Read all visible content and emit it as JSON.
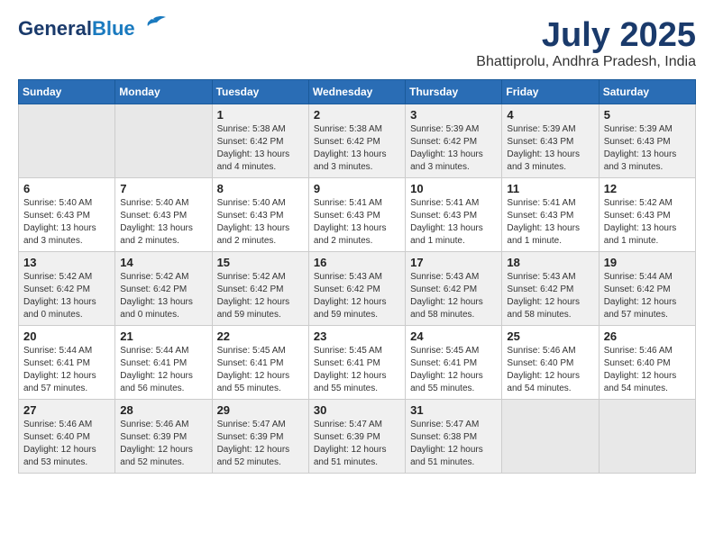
{
  "header": {
    "logo_line1": "General",
    "logo_line2": "Blue",
    "month": "July 2025",
    "location": "Bhattiprolu, Andhra Pradesh, India"
  },
  "days_of_week": [
    "Sunday",
    "Monday",
    "Tuesday",
    "Wednesday",
    "Thursday",
    "Friday",
    "Saturday"
  ],
  "weeks": [
    [
      {
        "day": "",
        "info": ""
      },
      {
        "day": "",
        "info": ""
      },
      {
        "day": "1",
        "info": "Sunrise: 5:38 AM\nSunset: 6:42 PM\nDaylight: 13 hours\nand 4 minutes."
      },
      {
        "day": "2",
        "info": "Sunrise: 5:38 AM\nSunset: 6:42 PM\nDaylight: 13 hours\nand 3 minutes."
      },
      {
        "day": "3",
        "info": "Sunrise: 5:39 AM\nSunset: 6:42 PM\nDaylight: 13 hours\nand 3 minutes."
      },
      {
        "day": "4",
        "info": "Sunrise: 5:39 AM\nSunset: 6:43 PM\nDaylight: 13 hours\nand 3 minutes."
      },
      {
        "day": "5",
        "info": "Sunrise: 5:39 AM\nSunset: 6:43 PM\nDaylight: 13 hours\nand 3 minutes."
      }
    ],
    [
      {
        "day": "6",
        "info": "Sunrise: 5:40 AM\nSunset: 6:43 PM\nDaylight: 13 hours\nand 3 minutes."
      },
      {
        "day": "7",
        "info": "Sunrise: 5:40 AM\nSunset: 6:43 PM\nDaylight: 13 hours\nand 2 minutes."
      },
      {
        "day": "8",
        "info": "Sunrise: 5:40 AM\nSunset: 6:43 PM\nDaylight: 13 hours\nand 2 minutes."
      },
      {
        "day": "9",
        "info": "Sunrise: 5:41 AM\nSunset: 6:43 PM\nDaylight: 13 hours\nand 2 minutes."
      },
      {
        "day": "10",
        "info": "Sunrise: 5:41 AM\nSunset: 6:43 PM\nDaylight: 13 hours\nand 1 minute."
      },
      {
        "day": "11",
        "info": "Sunrise: 5:41 AM\nSunset: 6:43 PM\nDaylight: 13 hours\nand 1 minute."
      },
      {
        "day": "12",
        "info": "Sunrise: 5:42 AM\nSunset: 6:43 PM\nDaylight: 13 hours\nand 1 minute."
      }
    ],
    [
      {
        "day": "13",
        "info": "Sunrise: 5:42 AM\nSunset: 6:42 PM\nDaylight: 13 hours\nand 0 minutes."
      },
      {
        "day": "14",
        "info": "Sunrise: 5:42 AM\nSunset: 6:42 PM\nDaylight: 13 hours\nand 0 minutes."
      },
      {
        "day": "15",
        "info": "Sunrise: 5:42 AM\nSunset: 6:42 PM\nDaylight: 12 hours\nand 59 minutes."
      },
      {
        "day": "16",
        "info": "Sunrise: 5:43 AM\nSunset: 6:42 PM\nDaylight: 12 hours\nand 59 minutes."
      },
      {
        "day": "17",
        "info": "Sunrise: 5:43 AM\nSunset: 6:42 PM\nDaylight: 12 hours\nand 58 minutes."
      },
      {
        "day": "18",
        "info": "Sunrise: 5:43 AM\nSunset: 6:42 PM\nDaylight: 12 hours\nand 58 minutes."
      },
      {
        "day": "19",
        "info": "Sunrise: 5:44 AM\nSunset: 6:42 PM\nDaylight: 12 hours\nand 57 minutes."
      }
    ],
    [
      {
        "day": "20",
        "info": "Sunrise: 5:44 AM\nSunset: 6:41 PM\nDaylight: 12 hours\nand 57 minutes."
      },
      {
        "day": "21",
        "info": "Sunrise: 5:44 AM\nSunset: 6:41 PM\nDaylight: 12 hours\nand 56 minutes."
      },
      {
        "day": "22",
        "info": "Sunrise: 5:45 AM\nSunset: 6:41 PM\nDaylight: 12 hours\nand 55 minutes."
      },
      {
        "day": "23",
        "info": "Sunrise: 5:45 AM\nSunset: 6:41 PM\nDaylight: 12 hours\nand 55 minutes."
      },
      {
        "day": "24",
        "info": "Sunrise: 5:45 AM\nSunset: 6:41 PM\nDaylight: 12 hours\nand 55 minutes."
      },
      {
        "day": "25",
        "info": "Sunrise: 5:46 AM\nSunset: 6:40 PM\nDaylight: 12 hours\nand 54 minutes."
      },
      {
        "day": "26",
        "info": "Sunrise: 5:46 AM\nSunset: 6:40 PM\nDaylight: 12 hours\nand 54 minutes."
      }
    ],
    [
      {
        "day": "27",
        "info": "Sunrise: 5:46 AM\nSunset: 6:40 PM\nDaylight: 12 hours\nand 53 minutes."
      },
      {
        "day": "28",
        "info": "Sunrise: 5:46 AM\nSunset: 6:39 PM\nDaylight: 12 hours\nand 52 minutes."
      },
      {
        "day": "29",
        "info": "Sunrise: 5:47 AM\nSunset: 6:39 PM\nDaylight: 12 hours\nand 52 minutes."
      },
      {
        "day": "30",
        "info": "Sunrise: 5:47 AM\nSunset: 6:39 PM\nDaylight: 12 hours\nand 51 minutes."
      },
      {
        "day": "31",
        "info": "Sunrise: 5:47 AM\nSunset: 6:38 PM\nDaylight: 12 hours\nand 51 minutes."
      },
      {
        "day": "",
        "info": ""
      },
      {
        "day": "",
        "info": ""
      }
    ]
  ]
}
